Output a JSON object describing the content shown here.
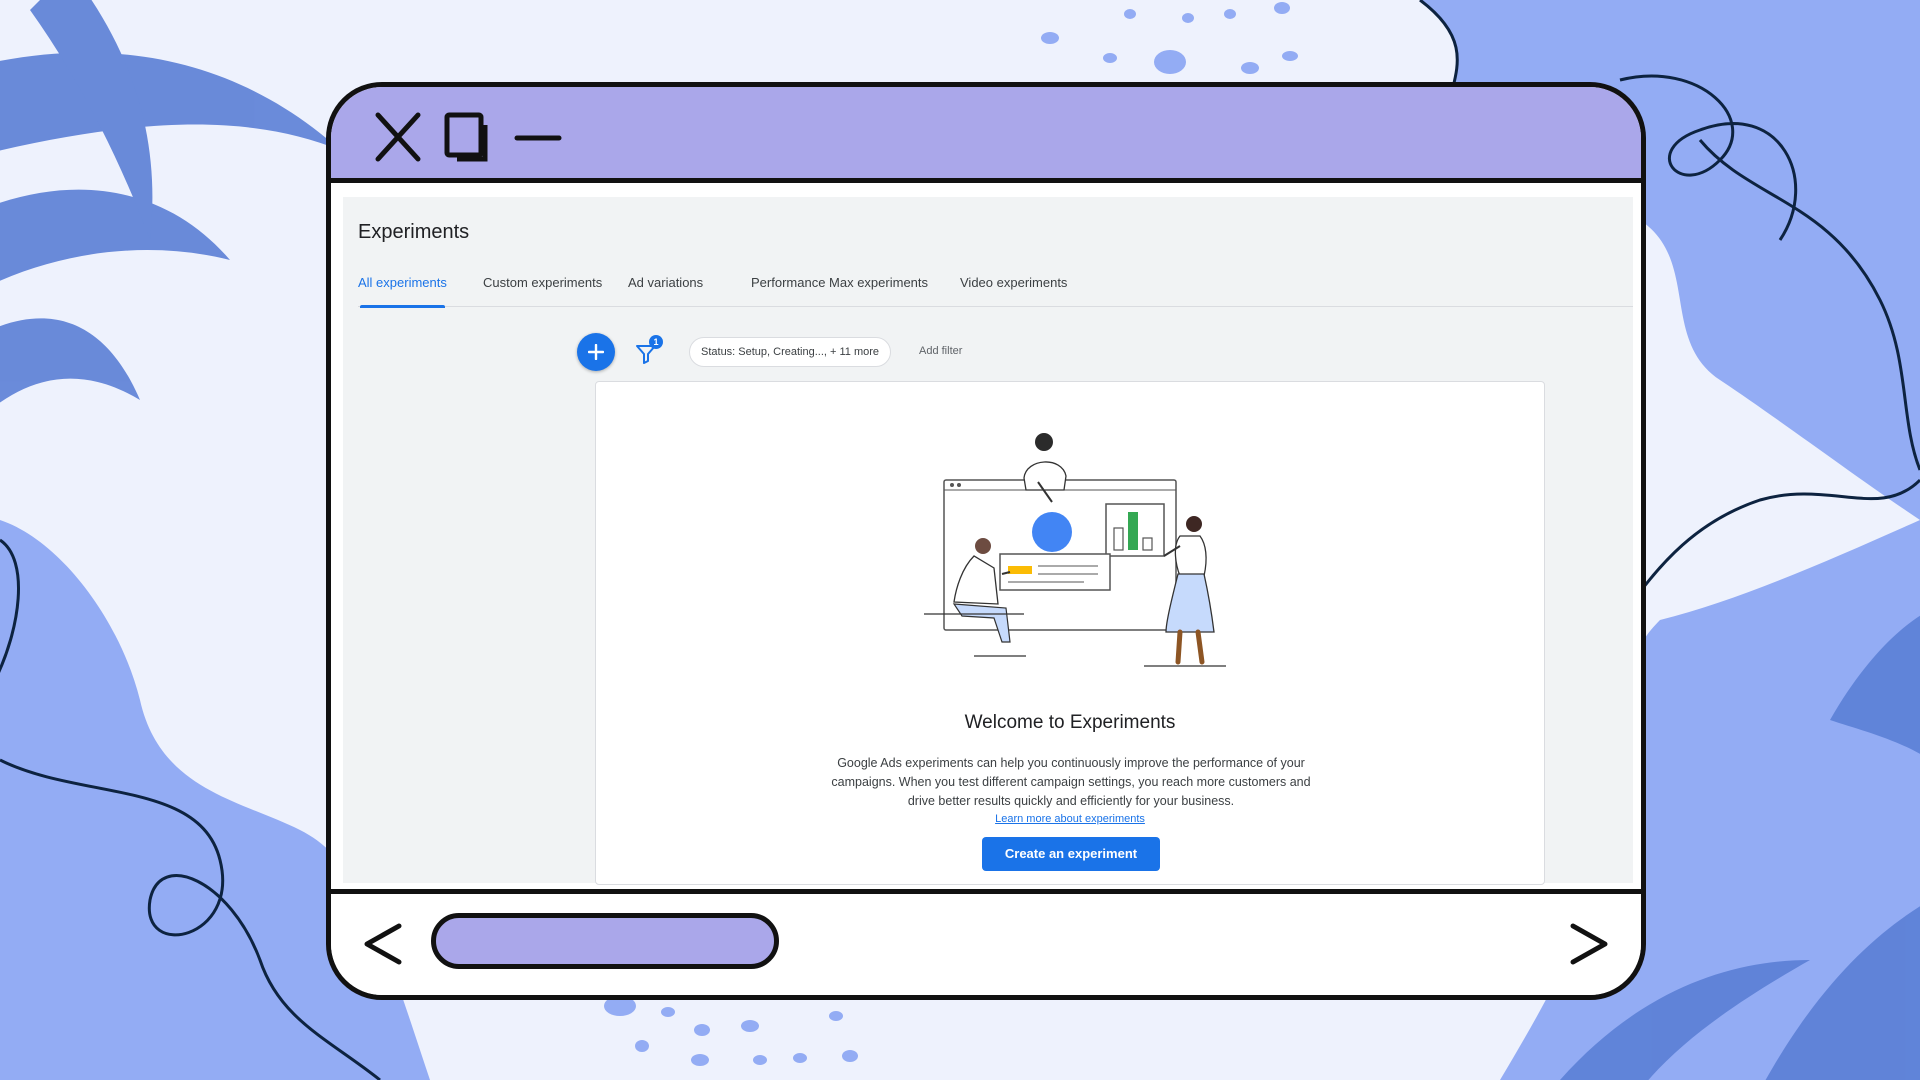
{
  "page": {
    "title": "Experiments"
  },
  "tabs": [
    {
      "label": "All experiments",
      "active": true
    },
    {
      "label": "Custom experiments",
      "active": false
    },
    {
      "label": "Ad variations",
      "active": false
    },
    {
      "label": "Performance Max experiments",
      "active": false
    },
    {
      "label": "Video experiments",
      "active": false
    }
  ],
  "toolbar": {
    "filter_count": "1",
    "status_chip": "Status: Setup, Creating..., + 11 more",
    "add_filter": "Add filter"
  },
  "empty_state": {
    "title": "Welcome to Experiments",
    "body": "Google Ads experiments can help you continuously improve the performance of your campaigns. When you test different campaign settings, you reach more customers and drive better results quickly and efficiently for your business.",
    "learn_more": "Learn more about experiments",
    "cta": "Create an experiment"
  },
  "colors": {
    "accent": "#1a73e8",
    "window_chrome": "#aaa7ea",
    "background": "#eef2fd",
    "leaf": "#5b7fd6"
  },
  "icons": {
    "window_close": "close-icon",
    "window_maximize": "maximize-icon",
    "window_minimize": "minimize-icon",
    "add": "plus-icon",
    "filter": "filter-icon",
    "nav_back": "chevron-left-icon",
    "nav_forward": "chevron-right-icon"
  }
}
